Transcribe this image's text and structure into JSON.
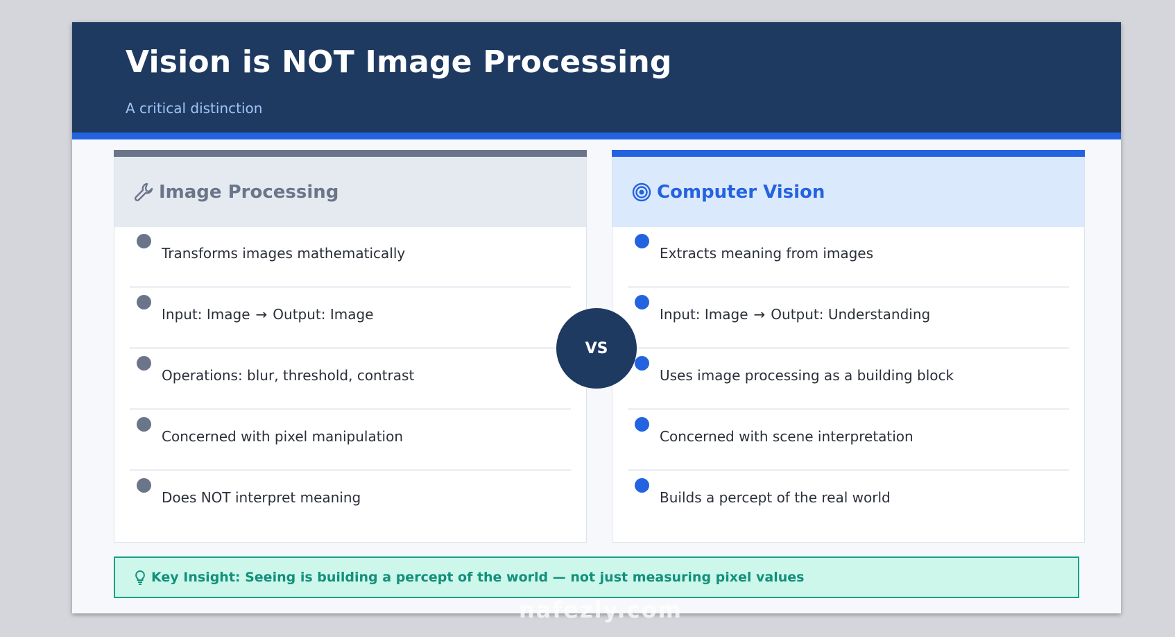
{
  "slide": {
    "title": "Vision is NOT Image Processing",
    "subtitle": "A critical distinction"
  },
  "left_panel": {
    "icon": "wrench-icon",
    "title": "Image Processing",
    "items": [
      {
        "text": "Transforms images mathematically"
      },
      {
        "text_before": "Input: Image",
        "arrow": "→",
        "text_after": "Output: Image"
      },
      {
        "text": "Operations: blur, threshold, contrast"
      },
      {
        "text": "Concerned with pixel manipulation"
      },
      {
        "text": "Does NOT interpret meaning"
      }
    ]
  },
  "right_panel": {
    "icon": "target-icon",
    "title": "Computer Vision",
    "items": [
      {
        "text": "Extracts meaning from images"
      },
      {
        "text_before": "Input: Image",
        "arrow": "→",
        "text_after": "Output: Understanding"
      },
      {
        "text": "Uses image processing as a building block"
      },
      {
        "text": "Concerned with scene interpretation"
      },
      {
        "text": "Builds a percept of the real world"
      }
    ]
  },
  "vs_label": "VS",
  "insight": {
    "icon": "lightbulb-icon",
    "text": "Key Insight: Seeing is building a percept of the world — not just measuring pixel values"
  },
  "watermark": "nafezly.com",
  "colors": {
    "header": "#1f3a61",
    "accent_blue": "#2463e0",
    "gray": "#6b7589",
    "insight_bg": "#cdf7ea",
    "insight_text": "#12907b"
  }
}
